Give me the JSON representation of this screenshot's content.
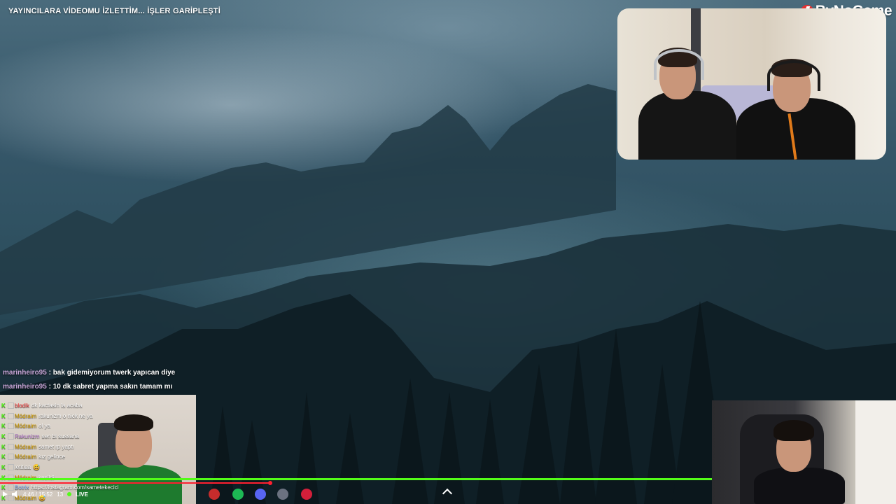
{
  "video": {
    "title": "YAYINCILARA VİDEOMU İZLETTİM... İŞLER GARİPLEŞTİ"
  },
  "branding": {
    "logo_text": "ByNoGame",
    "logo_color": "#e53030"
  },
  "overlay_chat": [
    {
      "user": "marinheiro95",
      "text": ": bak gidemiyorum twerk yapıcan diye"
    },
    {
      "user": "marinheiro95",
      "text": ": 10 dk sabret yapma sakın tamam mı"
    }
  ],
  "chat": [
    {
      "user": "blodik",
      "text": "dk kactasin la acaba",
      "user_color": "#ff4d4d"
    },
    {
      "user": "Mödraim",
      "text": "rakunizm o nick ne ya",
      "user_color": "#d6a000"
    },
    {
      "user": "Mödraim",
      "text": "ol ya",
      "user_color": "#d6a000"
    },
    {
      "user": "Rakunizm",
      "text": "sen bi sussana",
      "user_color": "#c38ad9"
    },
    {
      "user": "Mödraim",
      "text": "samet rp yaptı",
      "user_color": "#d6a000"
    },
    {
      "user": "Mödraim",
      "text": "kız gelince",
      "user_color": "#d6a000"
    },
    {
      "user": "letitiaa",
      "text": "😅",
      "user_color": "#ffffff"
    },
    {
      "user": "Mödraim",
      "text": "kesildi",
      "user_color": "#d6a000"
    },
    {
      "user": "Botrix",
      "text": "https://instagram.com/sametekecici",
      "user_color": "#8fb8ff"
    },
    {
      "user": "Mödraim",
      "text": "😅",
      "user_color": "#d6a000"
    }
  ],
  "player": {
    "time": "4:46 / 15:52",
    "viewers": "13",
    "live_label": "LIVE",
    "progress": 0.38,
    "accent": "#53fc18",
    "progress_color": "#ff2030"
  }
}
